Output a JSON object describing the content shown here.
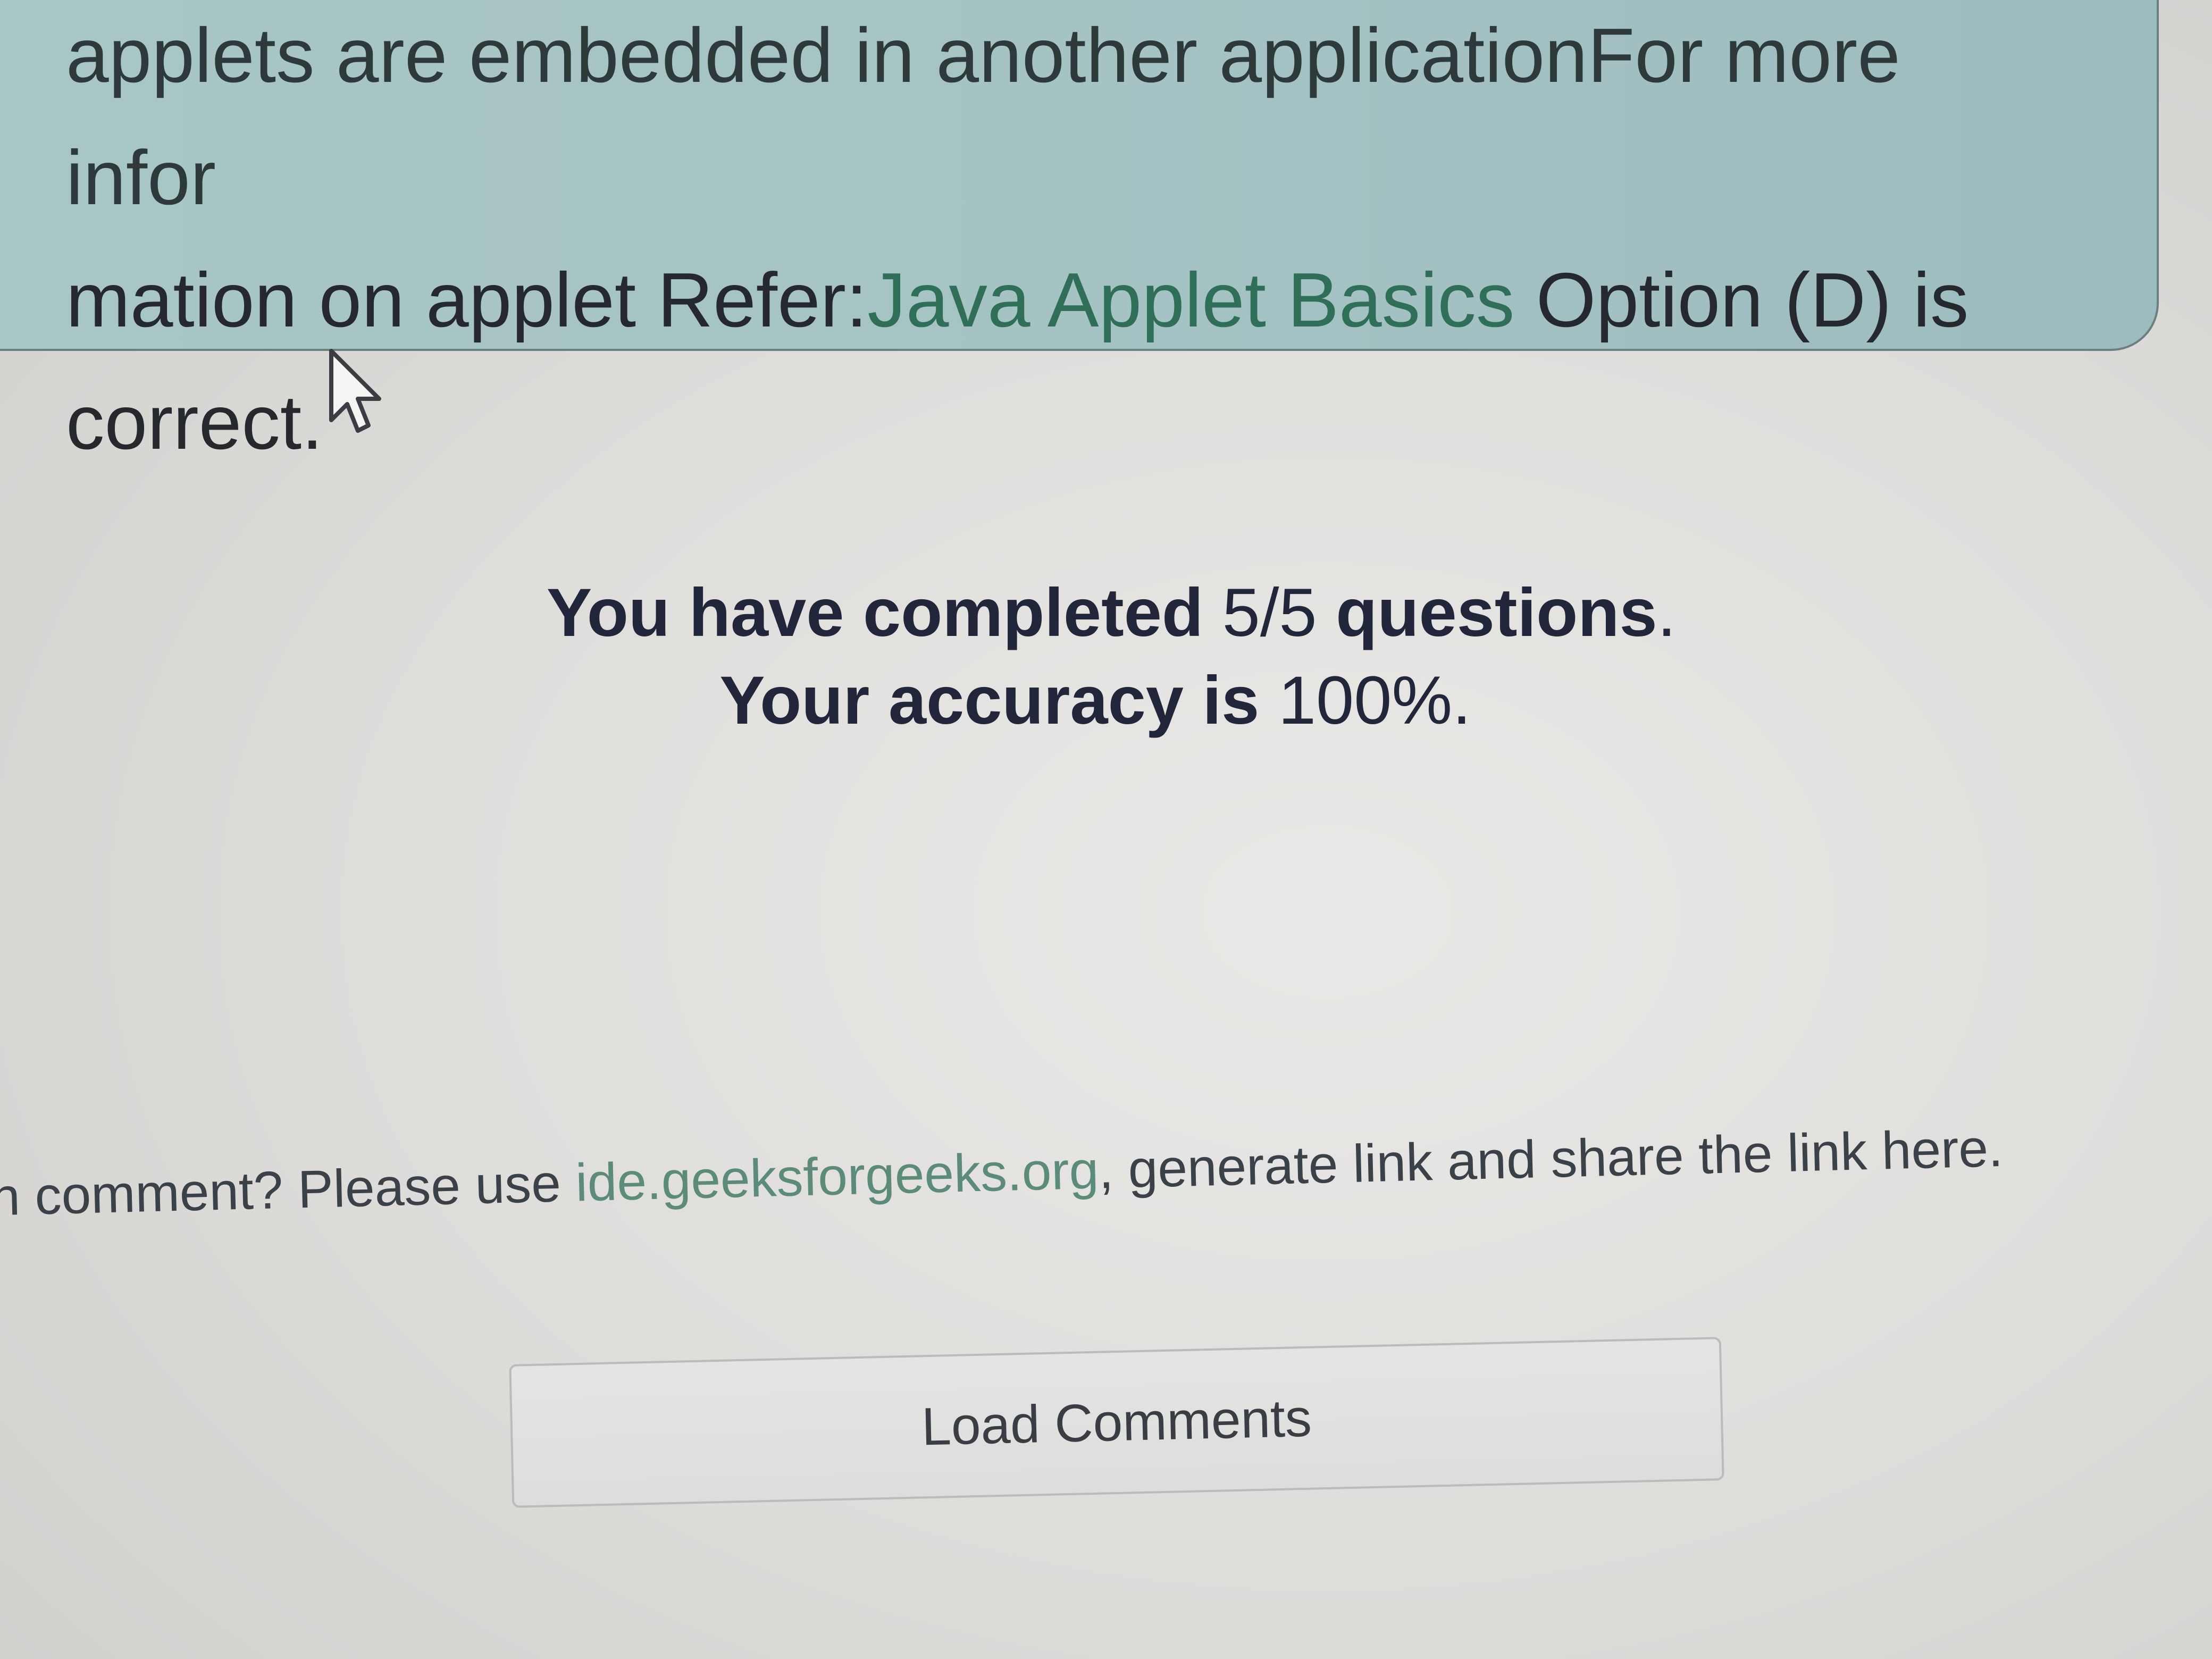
{
  "explanation": {
    "line1": "applets are embedded in another applicationFor more infor",
    "line2_prefix": "mation on applet Refer:",
    "link": "Java Applet Basics",
    "line2_suffix": " Option (D) is",
    "line3": "correct."
  },
  "result": {
    "completed_prefix": "You have completed",
    "completed_value": "5/5",
    "completed_suffix": "questions",
    "completed_end": ".",
    "accuracy_prefix": "Your accuracy is",
    "accuracy_value": "100%",
    "accuracy_end": "."
  },
  "comment_prompt": {
    "prefix": "in comment? Please use ",
    "link": "ide.geeksforgeeks.org",
    "suffix": ", generate link and share the link here."
  },
  "load_comments_button": {
    "label": "Load Comments"
  },
  "icons": {
    "cursor": "mouse-pointer-icon"
  }
}
